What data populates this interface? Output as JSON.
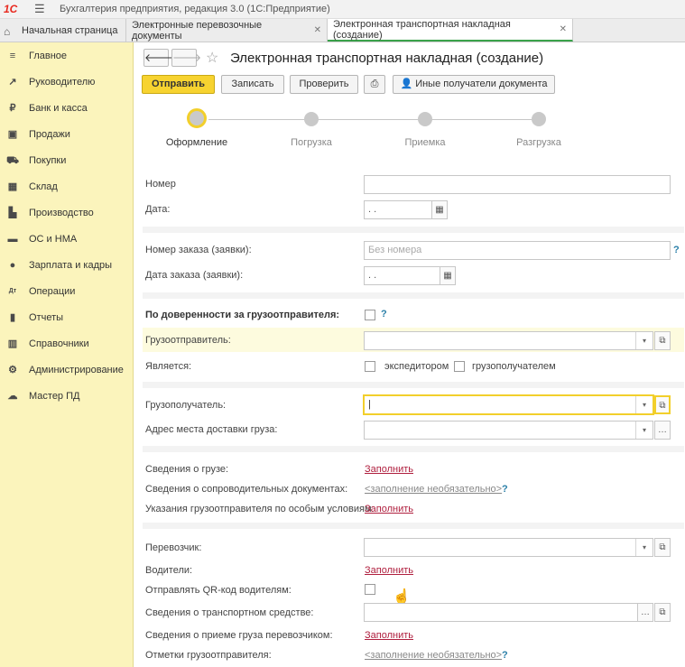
{
  "window": {
    "title_blurred": "Бухгалтерия предприятия, редакция 3.0 (1С:Предприятие)",
    "title_suffix": "(1С:Предприятие)"
  },
  "tabs": [
    {
      "label": "Начальная страница"
    },
    {
      "label": "Электронные перевозочные документы"
    },
    {
      "label": "Электронная транспортная накладная (создание)"
    }
  ],
  "sidebar": {
    "items": [
      {
        "label": "Главное",
        "icon": "menu-icon"
      },
      {
        "label": "Руководителю",
        "icon": "chart-up-icon"
      },
      {
        "label": "Банк и касса",
        "icon": "ruble-icon"
      },
      {
        "label": "Продажи",
        "icon": "bag-icon"
      },
      {
        "label": "Покупки",
        "icon": "cart-icon"
      },
      {
        "label": "Склад",
        "icon": "grid-icon"
      },
      {
        "label": "Производство",
        "icon": "factory-icon"
      },
      {
        "label": "ОС и НМА",
        "icon": "truck-icon"
      },
      {
        "label": "Зарплата и кадры",
        "icon": "person-icon"
      },
      {
        "label": "Операции",
        "icon": "dt-kt-icon"
      },
      {
        "label": "Отчеты",
        "icon": "bar-chart-icon"
      },
      {
        "label": "Справочники",
        "icon": "books-icon"
      },
      {
        "label": "Администрирование",
        "icon": "gear-icon"
      },
      {
        "label": "Мастер ПД",
        "icon": "cloud-icon"
      }
    ]
  },
  "document": {
    "title": "Электронная транспортная накладная (создание)"
  },
  "toolbar": {
    "send": "Отправить",
    "save": "Записать",
    "check": "Проверить",
    "other_recipients": "Иные получатели документа"
  },
  "steps": [
    {
      "label": "Оформление",
      "active": true
    },
    {
      "label": "Погрузка",
      "active": false
    },
    {
      "label": "Приемка",
      "active": false
    },
    {
      "label": "Разгрузка",
      "active": false
    }
  ],
  "form": {
    "number_label": "Номер",
    "date_label": "Дата:",
    "date_value": ". .",
    "order_number_label": "Номер заказа (заявки):",
    "order_number_placeholder": "Без номера",
    "order_date_label": "Дата заказа (заявки):",
    "order_date_value": ". .",
    "proxy_label": "По доверенности за грузоотправителя:",
    "shipper_label": "Грузоотправитель:",
    "is_label": "Является:",
    "forwarder_label": "экспедитором",
    "consignee_option_label": "грузополучателем",
    "consignee_label": "Грузополучатель:",
    "delivery_address_label": "Адрес места доставки груза:",
    "cargo_info_label": "Сведения о грузе:",
    "cargo_info_link": "Заполнить",
    "accompanying_docs_label": "Сведения о сопроводительных документах:",
    "accompanying_docs_link": "<заполнение необязательно>",
    "special_conditions_label": "Указания грузоотправителя по особым условиям:",
    "special_conditions_link": "Заполнить",
    "carrier_label": "Перевозчик:",
    "drivers_label": "Водители:",
    "drivers_link": "Заполнить",
    "qr_label": "Отправлять QR-код водителям:",
    "vehicle_label": "Сведения о транспортном средстве:",
    "carrier_acceptance_label": "Сведения о приеме груза перевозчиком:",
    "carrier_acceptance_link": "Заполнить",
    "shipper_marks_label": "Отметки грузоотправителя:",
    "shipper_marks_link": "<заполнение необязательно>",
    "help": "?"
  },
  "colors": {
    "sidebar_bg": "#fbf4bc",
    "primary_button": "#f7d330",
    "active_tab_underline": "#3aa24b",
    "link": "#b0203f",
    "focus_border": "#f2cf2b"
  }
}
